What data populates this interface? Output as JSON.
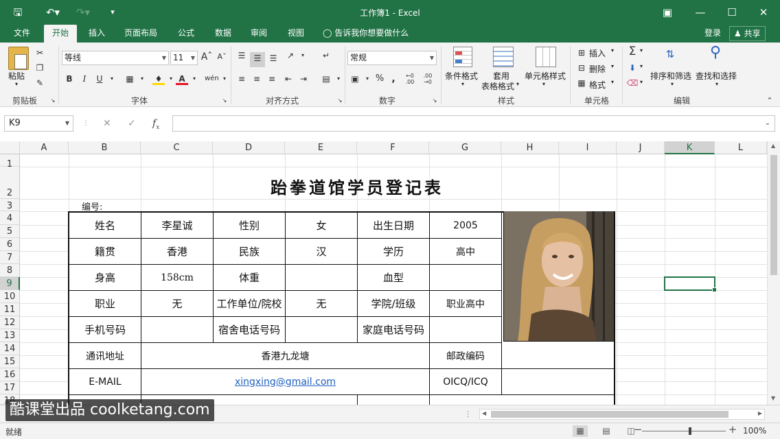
{
  "window": {
    "title": "工作簿1 - Excel"
  },
  "ribbon_tabs": [
    "文件",
    "开始",
    "插入",
    "页面布局",
    "公式",
    "数据",
    "审阅",
    "视图"
  ],
  "tell_me": "告诉我你想要做什么",
  "account": {
    "login": "登录",
    "share": "共享"
  },
  "ribbon": {
    "paste": "粘贴",
    "font_name": "等线",
    "font_size": "11",
    "number_format": "常规",
    "conditional_format": "条件格式",
    "format_as_table_1": "套用",
    "format_as_table_2": "表格格式",
    "cell_styles": "单元格样式",
    "insert": "插入",
    "delete": "删除",
    "format": "格式",
    "sort_filter": "排序和筛选",
    "find_select": "查找和选择",
    "groups": {
      "clipboard": "剪贴板",
      "font": "字体",
      "alignment": "对齐方式",
      "number": "数字",
      "styles": "样式",
      "cells": "单元格",
      "editing": "编辑"
    }
  },
  "formula_bar": {
    "name_box": "K9",
    "formula": ""
  },
  "columns": [
    "A",
    "B",
    "C",
    "D",
    "E",
    "F",
    "G",
    "H",
    "I",
    "J",
    "K",
    "L"
  ],
  "selected_column": "K",
  "rows": [
    "1",
    "2",
    "3",
    "4",
    "5",
    "6",
    "7",
    "8",
    "9",
    "10",
    "11",
    "12",
    "13",
    "14",
    "15",
    "16",
    "17",
    "18"
  ],
  "selected_row": "9",
  "sheet": {
    "title": "跆拳道馆学员登记表",
    "number_label": "编号:",
    "form": {
      "r1": [
        "姓名",
        "李星诚",
        "性别",
        "女",
        "出生日期",
        "2005"
      ],
      "r2": [
        "籍贯",
        "香港",
        "民族",
        "汉",
        "学历",
        "高中"
      ],
      "r3": [
        "身高",
        "158cm",
        "体重",
        "",
        "血型",
        ""
      ],
      "r4": [
        "职业",
        "无",
        "工作单位/院校",
        "无",
        "学院/班级",
        "职业高中"
      ],
      "r5": [
        "手机号码",
        "",
        "宿舍电话号码",
        "",
        "家庭电话号码",
        ""
      ],
      "address_label": "通讯地址",
      "address": "香港九龙塘",
      "postcode_label": "邮政编码",
      "postcode": "",
      "email_label": "E-MAIL",
      "email": "xingxing@gmail.com",
      "oicq_label": "OICQ/ICQ",
      "oicq": ""
    }
  },
  "watermark": "酷课堂出品 coolketang.com",
  "status": {
    "ready": "就绪",
    "zoom": "100%"
  },
  "colors": {
    "excel_green": "#217346",
    "link_blue": "#1f5fbf"
  }
}
